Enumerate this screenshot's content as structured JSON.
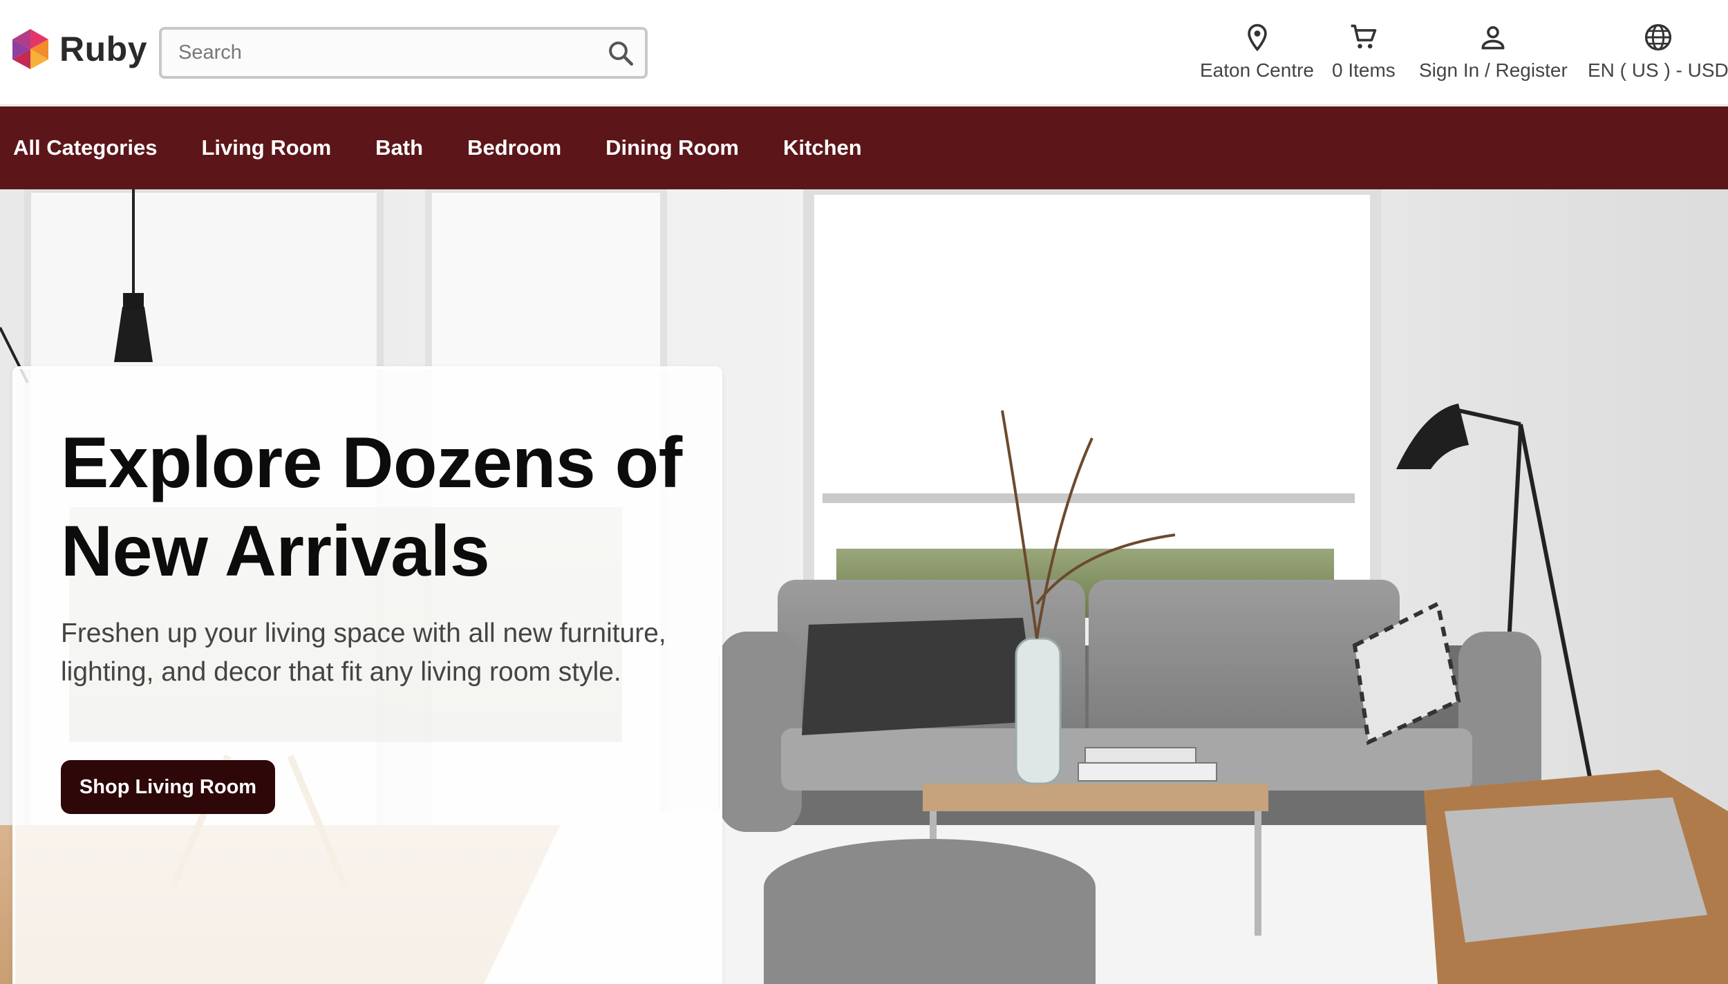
{
  "brand": {
    "name": "Ruby",
    "logo_icon": "ruby-hexagon-logo",
    "colors": [
      "#e4356b",
      "#f28b2a",
      "#8e3fa0",
      "#c42a52"
    ]
  },
  "search": {
    "placeholder": "Search",
    "value": "",
    "icon": "search-icon"
  },
  "header_utilities": {
    "store": {
      "label": "Eaton Centre",
      "icon": "location-pin-icon"
    },
    "cart": {
      "label": "0 Items",
      "icon": "cart-icon"
    },
    "account": {
      "label": "Sign In / Register",
      "icon": "person-icon"
    },
    "locale": {
      "label": "EN ( US ) - USD",
      "icon": "globe-icon"
    }
  },
  "nav": {
    "background": "#5c161a",
    "items": [
      "All Categories",
      "Living Room",
      "Bath",
      "Bedroom",
      "Dining Room",
      "Kitchen"
    ]
  },
  "hero": {
    "title": "Explore Dozens of New Arrivals",
    "description": "Freshen up your living space with all new furniture, lighting, and decor that fit any living room style.",
    "cta_label": "Shop Living Room",
    "cta_color": "#2e0709"
  }
}
